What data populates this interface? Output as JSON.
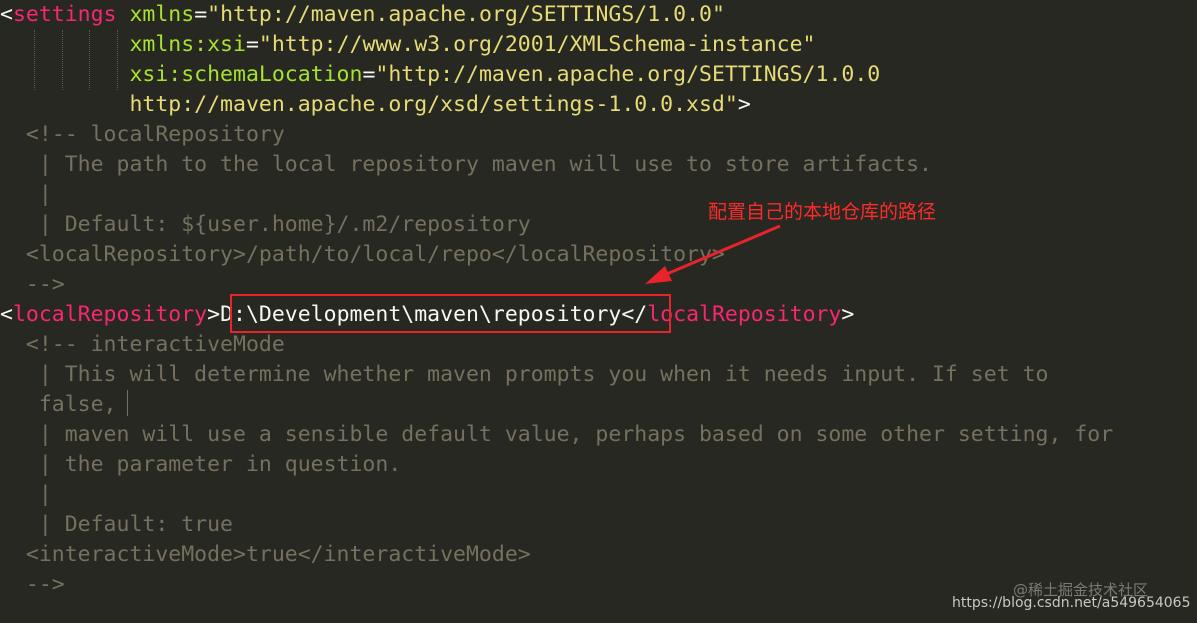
{
  "code": {
    "l1": {
      "lt": "<",
      "tag": "settings",
      "sp": " ",
      "attr": "xmlns",
      "eq": "=",
      "val": "\"http://maven.apache.org/SETTINGS/1.0.0\""
    },
    "l2": {
      "indent": "          ",
      "attr": "xmlns:xsi",
      "eq": "=",
      "val": "\"http://www.w3.org/2001/XMLSchema-instance\""
    },
    "l3": {
      "indent": "          ",
      "attr": "xsi:schemaLocation",
      "eq": "=",
      "val": "\"http://maven.apache.org/SETTINGS/1.0.0"
    },
    "l4": {
      "indent": "          ",
      "val": "http://maven.apache.org/xsd/settings-1.0.0.xsd\"",
      "gt": ">"
    },
    "l5": "  <!-- localRepository",
    "l6": "   | The path to the local repository maven will use to store artifacts.",
    "l7": "   |",
    "l8": "   | Default: ${user.home}/.m2/repository",
    "l9": "  <localRepository>/path/to/local/repo</localRepository>",
    "l10": "  -->",
    "l11": {
      "lt": "<",
      "tag": "localRepository",
      "gt": ">",
      "value": "D:\\Development\\maven\\repository",
      "lt2": "</",
      "tag2": "localRepository",
      "gt2": ">"
    },
    "l12": "  <!-- interactiveMode",
    "l13": "   | This will determine whether maven prompts you when it needs input. If set to",
    "l14": "   false,",
    "l15": "   | maven will use a sensible default value, perhaps based on some other setting, for",
    "l16": "   | the parameter in question.",
    "l17": "   |",
    "l18": "   | Default: true",
    "l19": "  <interactiveMode>true</interactiveMode>",
    "l20": "  -->"
  },
  "annotation": {
    "text": "配置自己的本地仓库的路径",
    "color": "#ff2a2a"
  },
  "watermark": {
    "top": "@稀土掘金技术社区",
    "bottom": "https://blog.csdn.net/a549654065"
  },
  "colors": {
    "background": "#272822",
    "tag": "#f92672",
    "attribute": "#a6e22e",
    "string": "#e6db74",
    "comment": "#75715e",
    "highlight_box": "#e8232c"
  }
}
